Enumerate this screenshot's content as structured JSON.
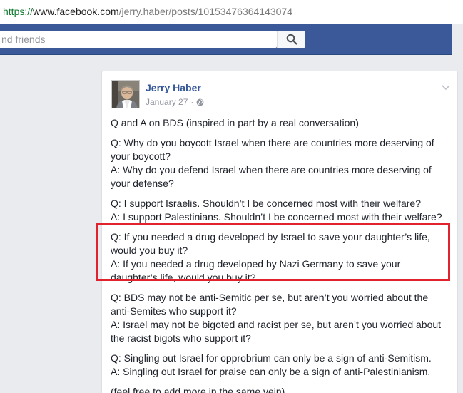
{
  "browser": {
    "url_scheme": "https://",
    "url_host": "www.facebook.com",
    "url_path": "/jerry.haber/posts/10153476364143074"
  },
  "header": {
    "search_placeholder": "nd friends",
    "search_icon": "search-icon"
  },
  "post": {
    "author": "Jerry Haber",
    "date": "January 27",
    "date_separator": "·",
    "audience_icon": "globe-icon",
    "menu_icon": "chevron-down-icon",
    "intro": "Q and A on BDS (inspired in part by a real conversation)",
    "qa": [
      {
        "q1": "Q: Why do you boycott Israel when there are countries more deserving of",
        "q2": "your boycott?",
        "a1": "A: Why do you defend Israel when there are countries more deserving of",
        "a2": "your defense?"
      },
      {
        "q1": "Q: I support Israelis. Shouldn’t I be concerned most with their welfare?",
        "a1": "A: I support Palestinians. Shouldn’t I be concerned most with their welfare?"
      },
      {
        "q1": "Q: If you needed a drug developed by Israel to save your daughter’s life,",
        "q2": "would you buy it?",
        "a1": "A: If you needed a drug developed by Nazi Germany to save your",
        "a2": "daughter’s life, would you buy it?"
      },
      {
        "q1": "Q: BDS may not be anti-Semitic per se, but aren’t you worried about the",
        "q2": "anti-Semites who support it?",
        "a1": "A: Israel may not be bigoted and racist per se, but aren’t you worried about",
        "a2": "the racist bigots who support it?"
      },
      {
        "q1": "Q: Singling out Israel for opprobrium can only be a sign of anti-Semitism.",
        "a1": "A: Singling out Israel for praise can only be a sign of anti-Palestinianism."
      }
    ],
    "closing": "(feel free to add more in the same vein)"
  },
  "colors": {
    "facebook_blue": "#3b5998",
    "link_blue": "#365899",
    "highlight_red": "#e0232d"
  }
}
